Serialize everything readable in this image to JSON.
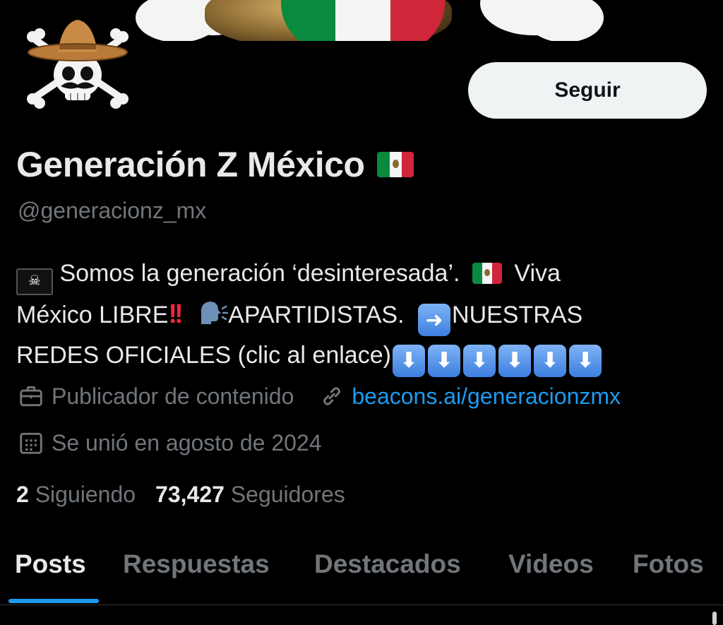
{
  "profile": {
    "display_name": "Generación Z México",
    "handle": "@generacionz_mx",
    "follow_label": "Seguir"
  },
  "bio": {
    "line1_part1": "Somos la generación ‘desinteresada’.",
    "line1_part2": "Viva",
    "line2_part1": "México LIBRE",
    "line2_part2": "APARTIDISTAS.",
    "line2_part3": "NUESTRAS",
    "line3_part1": "REDES OFICIALES (clic al enlace)",
    "arrow_right_glyph": "➜",
    "arrow_down_glyph": "⬇",
    "excl_glyph": "!!",
    "pirate_glyph": "☠"
  },
  "meta": {
    "category": "Publicador de contenido",
    "link": "beacons.ai/generacionzmx",
    "joined": "Se unió en agosto de 2024"
  },
  "stats": {
    "following_count": "2",
    "following_label": "Siguiendo",
    "followers_count": "73,427",
    "followers_label": "Seguidores"
  },
  "tabs": {
    "posts": "Posts",
    "replies": "Respuestas",
    "highlights": "Destacados",
    "videos": "Videos",
    "photos": "Fotos"
  },
  "icons": {
    "category": "briefcase-icon",
    "link": "link-icon",
    "joined": "calendar-icon"
  },
  "colors": {
    "background": "#000000",
    "text_primary": "#e7e9ea",
    "text_secondary": "#71767b",
    "accent": "#1d9bf0",
    "button_bg": "#eff3f4"
  }
}
